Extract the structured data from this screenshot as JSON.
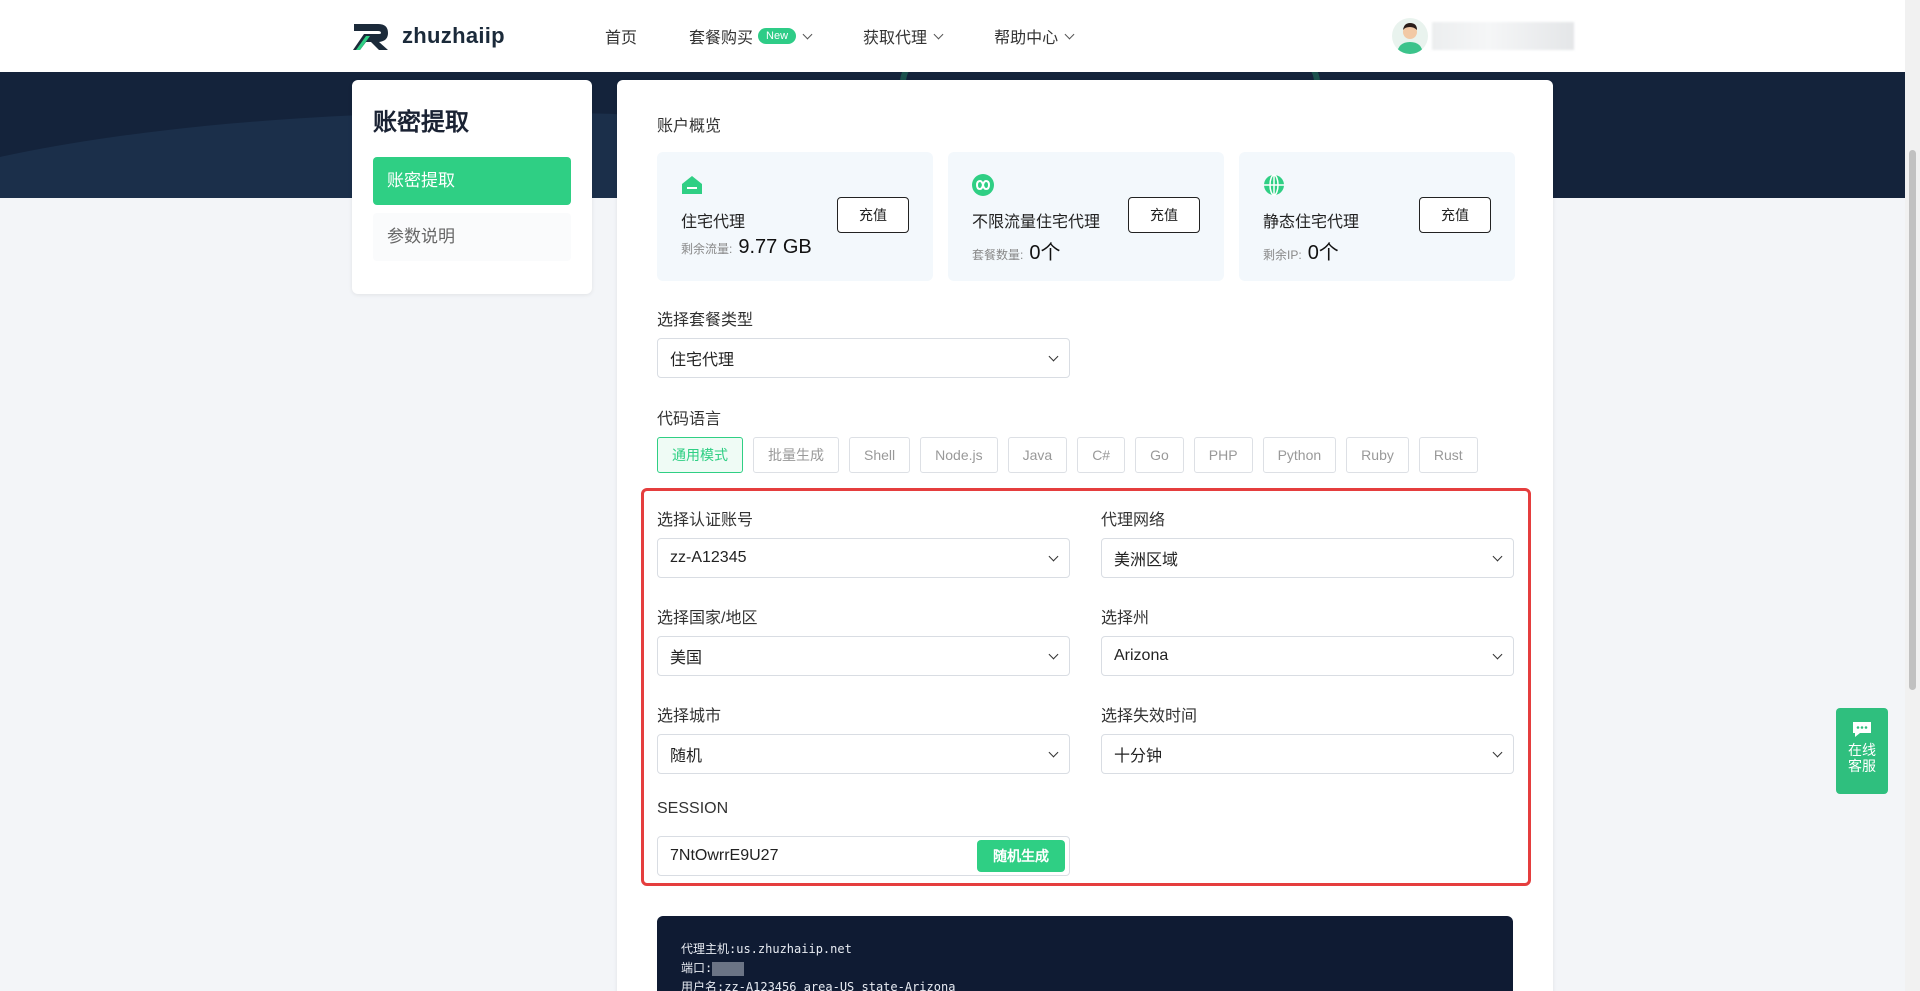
{
  "brand": {
    "name": "zhuzhaiip"
  },
  "nav": [
    {
      "label": "首页"
    },
    {
      "label": "套餐购买",
      "badge": "New"
    },
    {
      "label": "获取代理"
    },
    {
      "label": "帮助中心"
    }
  ],
  "sidebar": {
    "title": "账密提取",
    "items": [
      {
        "label": "账密提取",
        "active": true
      },
      {
        "label": "参数说明",
        "active": false
      }
    ]
  },
  "overview": {
    "title": "账户概览",
    "cards": [
      {
        "icon": "home-icon",
        "name": "住宅代理",
        "sub_label": "剩余流量:",
        "value": "9.77 GB",
        "button": "充值"
      },
      {
        "icon": "infinity-icon",
        "name": "不限流量住宅代理",
        "sub_label": "套餐数量:",
        "value": "0个",
        "button": "充值"
      },
      {
        "icon": "globe-icon",
        "name": "静态住宅代理",
        "sub_label": "剩余IP:",
        "value": "0个",
        "button": "充值"
      }
    ]
  },
  "package": {
    "label": "选择套餐类型",
    "value": "住宅代理"
  },
  "languages": {
    "label": "代码语言",
    "items": [
      "通用模式",
      "批量生成",
      "Shell",
      "Node.js",
      "Java",
      "C#",
      "Go",
      "PHP",
      "Python",
      "Ruby",
      "Rust"
    ],
    "active": "通用模式"
  },
  "form": {
    "account": {
      "label": "选择认证账号",
      "value": "zz-A12345"
    },
    "network": {
      "label": "代理网络",
      "value": "美洲区域"
    },
    "country": {
      "label": "选择国家/地区",
      "value": "美国"
    },
    "state": {
      "label": "选择州",
      "value": "Arizona"
    },
    "city": {
      "label": "选择城市",
      "value": "随机"
    },
    "expire": {
      "label": "选择失效时间",
      "value": "十分钟"
    },
    "session": {
      "label": "SESSION",
      "value": "7NtOwrrE9U27",
      "button": "随机生成"
    }
  },
  "code": {
    "host_label": "代理主机:",
    "host": "us.zhuzhaiip.net",
    "port_label": "端口:",
    "user_label": "用户名:",
    "user": "zz-A123456_area-US_state-Arizona"
  },
  "chat": {
    "line1": "在线",
    "line2": "客服"
  },
  "colors": {
    "accent": "#2fcf84",
    "dark": "#14233b",
    "highlight": "#e53e3e"
  }
}
